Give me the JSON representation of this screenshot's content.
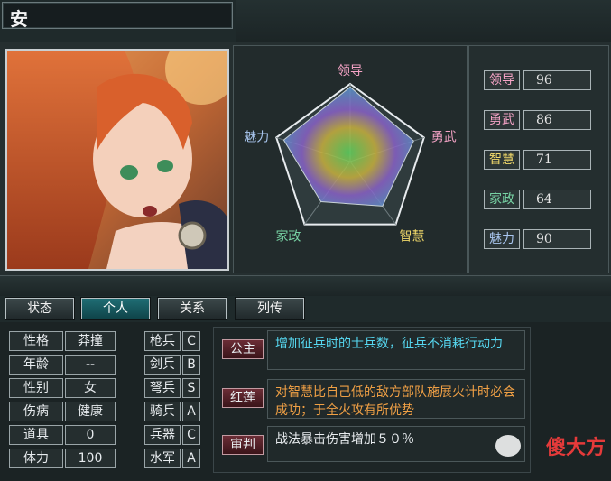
{
  "character": {
    "name": "安"
  },
  "radar": {
    "axes": [
      "领导",
      "勇武",
      "智慧",
      "家政",
      "魅力"
    ],
    "axis_colors": [
      "#f5a3c6",
      "#f5a3c6",
      "#f1d96a",
      "#78d4a5",
      "#a9c6ef"
    ],
    "values": [
      96,
      86,
      71,
      64,
      90
    ],
    "max": 100
  },
  "stats": [
    {
      "label": "领导",
      "value": "96",
      "color": "#f5a3c6"
    },
    {
      "label": "勇武",
      "value": "86",
      "color": "#f5a3c6"
    },
    {
      "label": "智慧",
      "value": "71",
      "color": "#f1d96a"
    },
    {
      "label": "家政",
      "value": "64",
      "color": "#78d4a5"
    },
    {
      "label": "魅力",
      "value": "90",
      "color": "#a9c6ef"
    }
  ],
  "tabs": [
    {
      "label": "状态",
      "active": false
    },
    {
      "label": "个人",
      "active": true
    },
    {
      "label": "关系",
      "active": false
    },
    {
      "label": "列传",
      "active": false
    }
  ],
  "profile": [
    {
      "label": "性格",
      "value": "莽撞"
    },
    {
      "label": "年龄",
      "value": "--"
    },
    {
      "label": "性别",
      "value": "女"
    },
    {
      "label": "伤病",
      "value": "健康"
    },
    {
      "label": "道具",
      "value": "0"
    },
    {
      "label": "体力",
      "value": "100"
    }
  ],
  "aptitude": [
    {
      "label": "枪兵",
      "grade": "C"
    },
    {
      "label": "剑兵",
      "grade": "B"
    },
    {
      "label": "弩兵",
      "grade": "S"
    },
    {
      "label": "骑兵",
      "grade": "A"
    },
    {
      "label": "兵器",
      "grade": "C"
    },
    {
      "label": "水军",
      "grade": "A"
    }
  ],
  "skills": [
    {
      "tag": "公主",
      "desc": "增加征兵时的士兵数，征兵不消耗行动力",
      "desc_color": "#56d7f0"
    },
    {
      "tag": "红莲",
      "desc": "对智慧比自己低的敌方部队施展火计时必会成功；于全火攻有所优势",
      "desc_color": "#f0a045"
    },
    {
      "tag": "审判",
      "desc": "战法暴击伤害增加５０％",
      "desc_color": "#e8ecef"
    }
  ],
  "watermark": "傻大方"
}
